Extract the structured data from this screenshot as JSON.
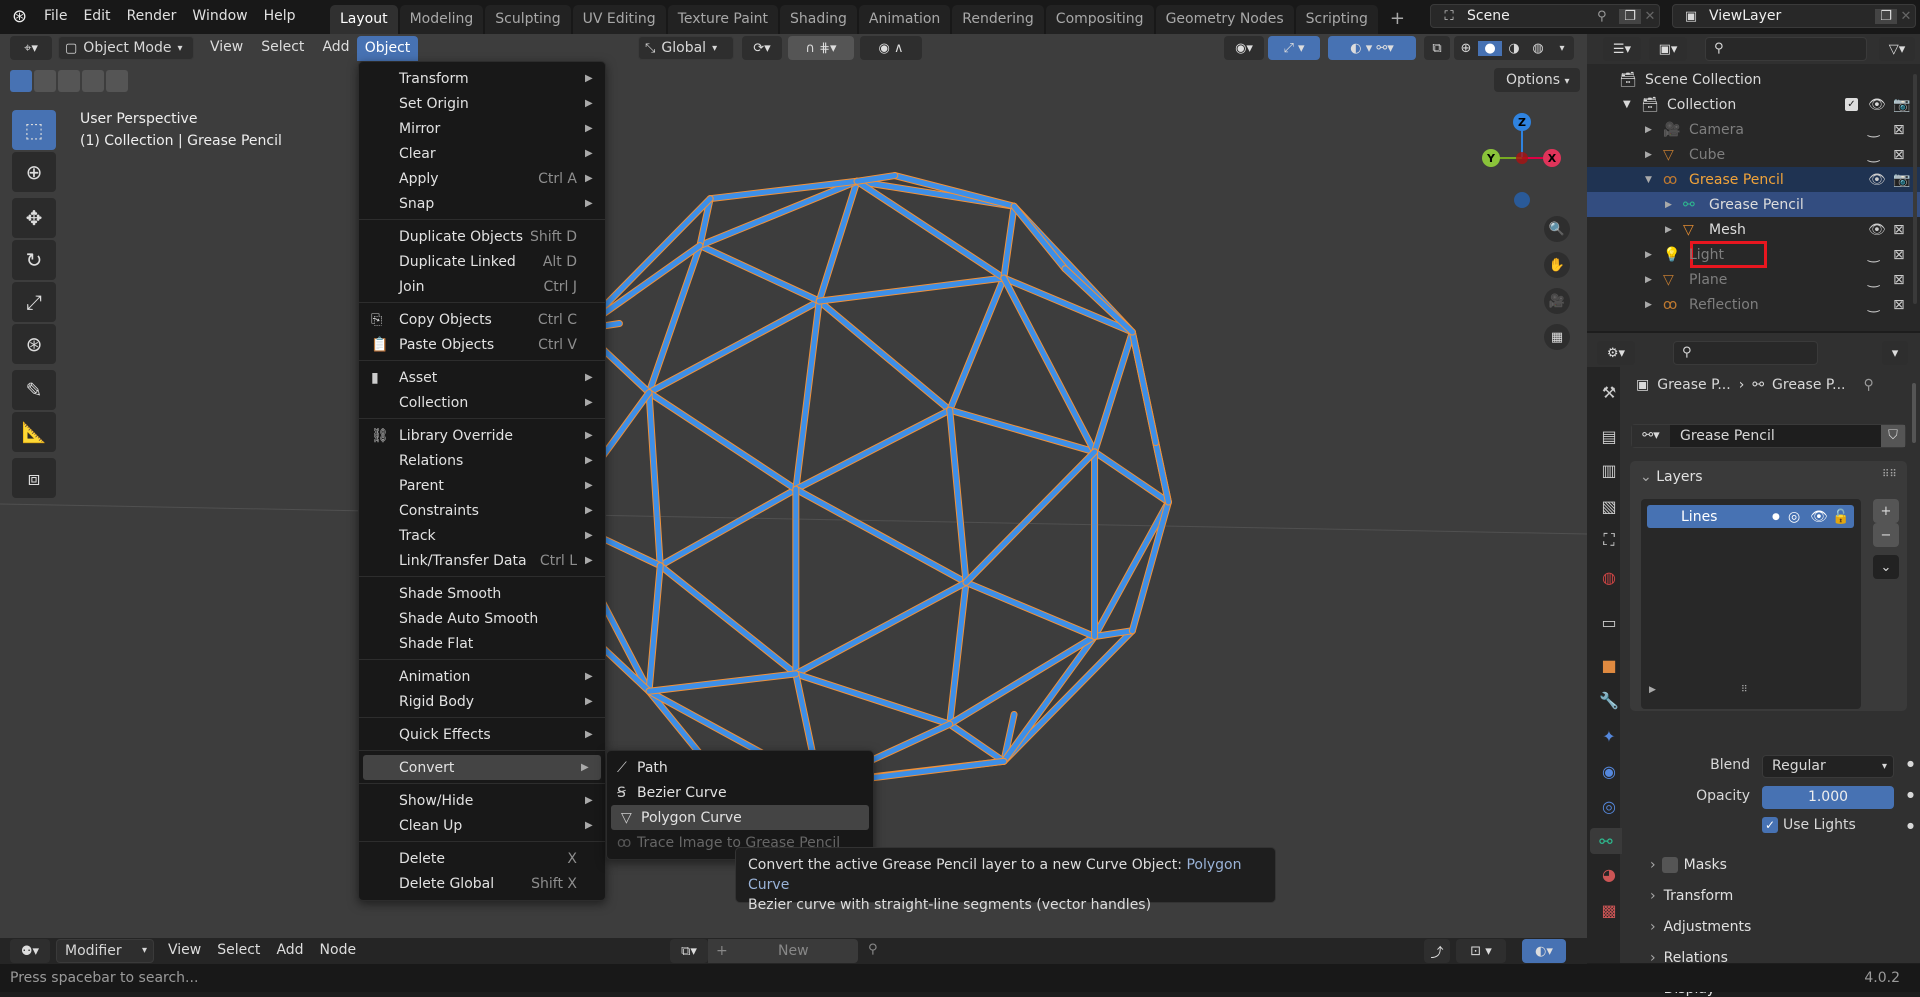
{
  "topbar": {
    "menus": [
      "File",
      "Edit",
      "Render",
      "Window",
      "Help"
    ],
    "workspaces": [
      "Layout",
      "Modeling",
      "Sculpting",
      "UV Editing",
      "Texture Paint",
      "Shading",
      "Animation",
      "Rendering",
      "Compositing",
      "Geometry Nodes",
      "Scripting"
    ],
    "active_workspace": "Layout",
    "add_tab": "+",
    "scene": "Scene",
    "view_layer": "ViewLayer"
  },
  "viewport": {
    "mode": "Object Mode",
    "menus": [
      "View",
      "Select",
      "Add",
      "Object"
    ],
    "orientation": "Global",
    "options": "Options",
    "perspective": "User Perspective",
    "context": "(1) Collection | Grease Pencil",
    "gizmo": {
      "z": "Z",
      "y": "Y",
      "x": "X"
    },
    "stroke_color": "#3d8fe8",
    "outline_color": "#f0913a"
  },
  "object_menu": {
    "groups": [
      [
        {
          "label": "Transform",
          "sub": true
        },
        {
          "label": "Set Origin",
          "sub": true
        },
        {
          "label": "Mirror",
          "sub": true
        },
        {
          "label": "Clear",
          "sub": true
        },
        {
          "label": "Apply",
          "shortcut": "Ctrl A",
          "sub": true
        },
        {
          "label": "Snap",
          "sub": true
        }
      ],
      [
        {
          "label": "Duplicate Objects",
          "shortcut": "Shift D"
        },
        {
          "label": "Duplicate Linked",
          "shortcut": "Alt D"
        },
        {
          "label": "Join",
          "shortcut": "Ctrl J"
        }
      ],
      [
        {
          "label": "Copy Objects",
          "shortcut": "Ctrl C",
          "icon": "copy-icon"
        },
        {
          "label": "Paste Objects",
          "shortcut": "Ctrl V",
          "icon": "paste-icon"
        }
      ],
      [
        {
          "label": "Asset",
          "sub": true,
          "icon": "asset-icon"
        },
        {
          "label": "Collection",
          "sub": true
        }
      ],
      [
        {
          "label": "Library Override",
          "sub": true,
          "icon": "library-override-icon"
        },
        {
          "label": "Relations",
          "sub": true
        },
        {
          "label": "Parent",
          "sub": true
        },
        {
          "label": "Constraints",
          "sub": true
        },
        {
          "label": "Track",
          "sub": true
        },
        {
          "label": "Link/Transfer Data",
          "shortcut": "Ctrl L",
          "sub": true
        }
      ],
      [
        {
          "label": "Shade Smooth"
        },
        {
          "label": "Shade Auto Smooth"
        },
        {
          "label": "Shade Flat"
        }
      ],
      [
        {
          "label": "Animation",
          "sub": true
        },
        {
          "label": "Rigid Body",
          "sub": true
        }
      ],
      [
        {
          "label": "Quick Effects",
          "sub": true
        }
      ],
      [
        {
          "label": "Convert",
          "sub": true,
          "highlighted": true
        }
      ],
      [
        {
          "label": "Show/Hide",
          "sub": true
        },
        {
          "label": "Clean Up",
          "sub": true
        }
      ],
      [
        {
          "label": "Delete",
          "shortcut": "X"
        },
        {
          "label": "Delete Global",
          "shortcut": "Shift X"
        }
      ]
    ]
  },
  "convert_menu": {
    "items": [
      {
        "label": "Path",
        "icon": "path-icon"
      },
      {
        "label": "Bezier Curve",
        "icon": "bezier-curve-icon"
      },
      {
        "label": "Polygon Curve",
        "icon": "polygon-curve-icon",
        "highlighted": true
      },
      {
        "label": "Trace Image to Grease Pencil",
        "icon": "grease-pencil-icon",
        "disabled": true
      }
    ]
  },
  "tooltip": {
    "line1": "Convert the active Grease Pencil layer to a new Curve Object:",
    "value": "Polygon Curve",
    "line2": "Bezier curve with straight-line segments (vector handles)"
  },
  "outliner": {
    "root": "Scene Collection",
    "collection": "Collection",
    "items": [
      {
        "name": "Camera",
        "dim": true
      },
      {
        "name": "Cube",
        "dim": true
      },
      {
        "name": "Grease Pencil",
        "active": true
      },
      {
        "name": "Grease Pencil",
        "child": true,
        "selected": true
      },
      {
        "name": "Mesh",
        "child": true,
        "boxed": true
      },
      {
        "name": "Light",
        "dim": true
      },
      {
        "name": "Plane",
        "dim": true
      },
      {
        "name": "Reflection",
        "dim": true
      }
    ]
  },
  "properties": {
    "breadcrumb": [
      "Grease P...",
      "Grease P..."
    ],
    "datablock": "Grease Pencil",
    "layers_title": "Layers",
    "layers": [
      "Lines"
    ],
    "blend_label": "Blend",
    "blend_value": "Regular",
    "opacity_label": "Opacity",
    "opacity_value": "1.000",
    "use_lights_label": "Use Lights",
    "use_lights": true,
    "masks_label": "Masks",
    "panels": [
      "Transform",
      "Adjustments",
      "Relations",
      "Display"
    ]
  },
  "bottom": {
    "editor": "Modifier",
    "menus": [
      "View",
      "Select",
      "Add",
      "Node"
    ],
    "new_label": "New"
  },
  "status": {
    "hint": "Press spacebar to search...",
    "version": "4.0.2"
  }
}
